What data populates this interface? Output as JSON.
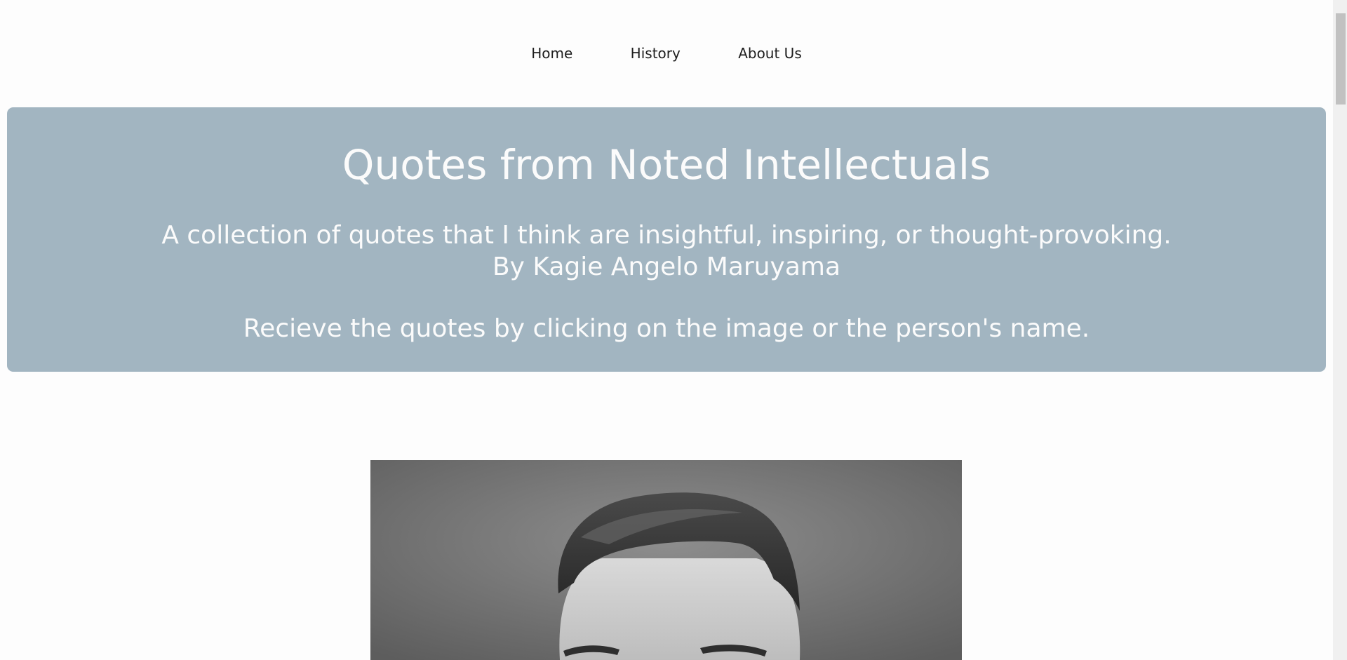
{
  "nav": {
    "items": [
      {
        "label": "Home"
      },
      {
        "label": "History"
      },
      {
        "label": "About Us"
      }
    ]
  },
  "hero": {
    "title": "Quotes from Noted Intellectuals",
    "description": "A collection of quotes that I think are insightful, inspiring, or thought-provoking.",
    "author": "By Kagie Angelo Maruyama",
    "instruction": "Recieve the quotes by clicking on the image or the person's name."
  },
  "colors": {
    "hero_background": "#a2b5c1",
    "hero_text": "#fbfbfb",
    "nav_text": "#1d1d1d"
  }
}
